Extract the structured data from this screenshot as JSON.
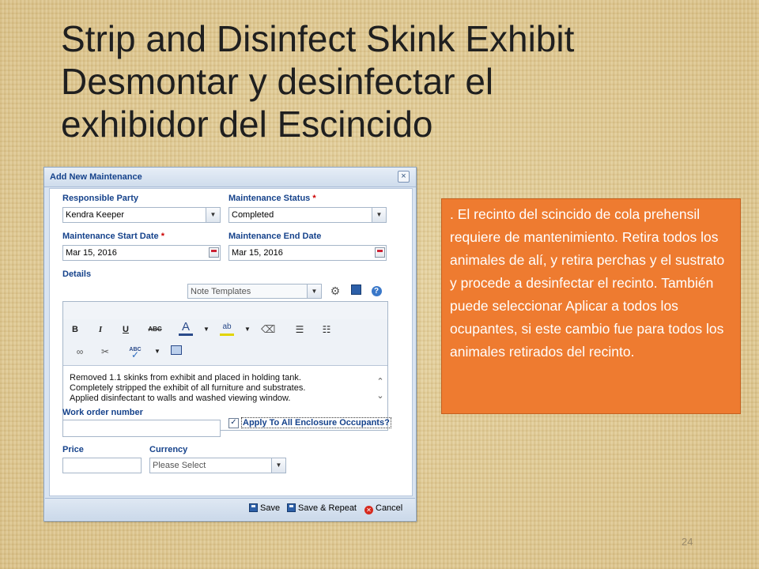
{
  "slide": {
    "title_lines": [
      "Strip and Disinfect Skink Exhibit",
      "Desmontar y desinfectar el",
      "exhibidor del Escincido"
    ],
    "page_number": "24"
  },
  "dialog": {
    "title": "Add New Maintenance",
    "close_glyph": "×",
    "responsible_party": {
      "label": "Responsible Party",
      "value": "Kendra Keeper"
    },
    "maintenance_status": {
      "label": "Maintenance Status",
      "required_mark": "*",
      "value": "Completed"
    },
    "start_date": {
      "label": "Maintenance Start Date",
      "required_mark": "*",
      "value": "Mar 15, 2016"
    },
    "end_date": {
      "label": "Maintenance End Date",
      "value": "Mar 15, 2016"
    },
    "details": {
      "label": "Details",
      "note_templates": "Note Templates",
      "toolbar": {
        "bold": "B",
        "italic": "I",
        "underline": "U",
        "strike": "ABC",
        "font_color": "A",
        "highlight": "ab",
        "spell": "ABC"
      },
      "text_lines": [
        "Removed 1.1 skinks from exhibit and placed in holding tank.",
        "Completely stripped the exhibit of all furniture and substrates.",
        "Applied disinfectant to walls and washed viewing window."
      ]
    },
    "work_order": {
      "label": "Work order number",
      "value": ""
    },
    "apply_all": {
      "label": "Apply To All Enclosure Occupants?",
      "checked": true,
      "check_glyph": "✓"
    },
    "price": {
      "label": "Price",
      "value": ""
    },
    "currency": {
      "label": "Currency",
      "placeholder": "Please Select"
    },
    "buttons": {
      "save": "Save",
      "save_repeat": "Save & Repeat",
      "cancel": "Cancel"
    }
  },
  "note": {
    "text": ". El recinto del scincido de cola prehensil requiere de mantenimiento.  Retira todos los animales de alí, y retira perchas y el sustrato y procede a desinfectar el recinto. También puede seleccionar Aplicar a todos los ocupantes, si este cambio fue para todos los animales retirados del recinto."
  },
  "colors": {
    "note_bg": "#ee7b30",
    "dialog_label": "#15428b",
    "required": "#cc0000"
  }
}
